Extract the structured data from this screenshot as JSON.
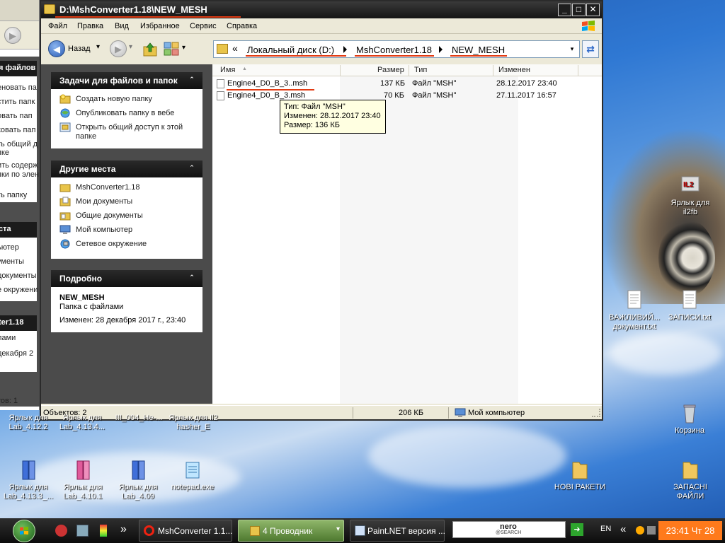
{
  "window": {
    "title": "D:\\MshConverter1.18\\NEW_MESH",
    "min_glyph": "_",
    "max_glyph": "□",
    "close_glyph": "✕"
  },
  "menu": [
    "Файл",
    "Правка",
    "Вид",
    "Избранное",
    "Сервис",
    "Справка"
  ],
  "toolbar": {
    "back_label": "Назад",
    "back_arrow": "◀",
    "forward_arrow": "▶",
    "dropdown_glyph": "▾"
  },
  "address": {
    "prefix": "«",
    "crumbs": [
      "Локальный диск (D:)",
      "MshConverter1.18",
      "NEW_MESH"
    ],
    "go_glyph": "⇄"
  },
  "tasks_panel": {
    "title": "Задачи для файлов и папок",
    "items": [
      "Создать новую папку",
      "Опубликовать папку в вебе",
      "Открыть общий доступ к этой",
      "папке"
    ]
  },
  "places_panel": {
    "title": "Другие места",
    "items": [
      "MshConverter1.18",
      "Мои документы",
      "Общие документы",
      "Мой компьютер",
      "Сетевое окружение"
    ]
  },
  "details_panel": {
    "title": "Подробно",
    "name": "NEW_MESH",
    "type": "Папка с файлами",
    "modified": "Изменен: 28 декабря 2017 г., 23:40"
  },
  "panel_chevron": "⌃",
  "columns": {
    "name": "Имя",
    "size": "Размер",
    "type": "Тип",
    "modified": "Изменен",
    "sort_glyph": "▲"
  },
  "files": [
    {
      "name": "Engine4_D0_B_3..msh",
      "size": "137 КБ",
      "type": "Файл \"MSH\"",
      "modified": "28.12.2017 23:40"
    },
    {
      "name": "Engine4_D0_B_3.msh",
      "size": "70 КБ",
      "type": "Файл \"MSH\"",
      "modified": "27.11.2017 16:57"
    }
  ],
  "tooltip": {
    "line1": "Тип: Файл \"MSH\"",
    "line2": "Изменен: 28.12.2017 23:40",
    "line3": "Размер: 136 КБ"
  },
  "status": {
    "objects": "Объектов: 2",
    "size": "206 КБ",
    "location": "Мой компьютер"
  },
  "bg_window": {
    "panel1_title": "я файлов",
    "panel1_lines": [
      "еновать па",
      "стить папк",
      "овать пап",
      "ковать пап",
      "ть общий д",
      "пке",
      "ить содерж",
      "пки по элен",
      "ть папку"
    ],
    "panel2_title": "ста",
    "panel2_lines": [
      "ьютер",
      "ументы",
      "документы",
      "е окружени"
    ],
    "panel3_title": "ter1.18",
    "panel3_lines": [
      "лами",
      "декабря 2"
    ],
    "status": "тов: 1"
  },
  "desktop_icons": [
    {
      "label1": "Ярлык для",
      "label2": "il2fb",
      "badge": "IL2"
    },
    {
      "label1": "ВАЖЛИВИЙ...",
      "label2": "документ.txt"
    },
    {
      "label1": "ЗАПИСИ.txt",
      "label2": ""
    },
    {
      "label1": "Корзина",
      "label2": ""
    },
    {
      "label1": "Ярлык для",
      "label2": "Lab_4.12.2"
    },
    {
      "label1": "Ярлык для",
      "label2": "Lab_4.13.4..."
    },
    {
      "label1": "!!!_004_Не-...",
      "label2": ""
    },
    {
      "label1": "Ярлык для Il2",
      "label2": "hasher_E"
    },
    {
      "label1": "Ярлык для",
      "label2": "Lab_4.13.3_..."
    },
    {
      "label1": "Ярлык для",
      "label2": "Lab_4.10.1"
    },
    {
      "label1": "Ярлык для",
      "label2": "Lab_4.09"
    },
    {
      "label1": "notepad.exe",
      "label2": ""
    },
    {
      "label1": "НОВІ РАКЕТИ",
      "label2": ""
    },
    {
      "label1": "ЗАПАСНІ",
      "label2": "ФАЙЛИ"
    }
  ],
  "taskbar": {
    "quick_more": "»",
    "tasks": [
      "MshConverter 1.1...",
      "4 Проводник",
      "Paint.NET версия ..."
    ],
    "task_dropdown": "▾",
    "nero_label": "nero",
    "nero_sub": "@SEARCH",
    "lang": "EN",
    "tray_more": "«",
    "clock": "23:41 Чт 28"
  },
  "colors": {
    "accent_underline": "#e23a12",
    "clock_bg": "#ff7a1c",
    "sidebar_bg": "#4b4b4b"
  }
}
